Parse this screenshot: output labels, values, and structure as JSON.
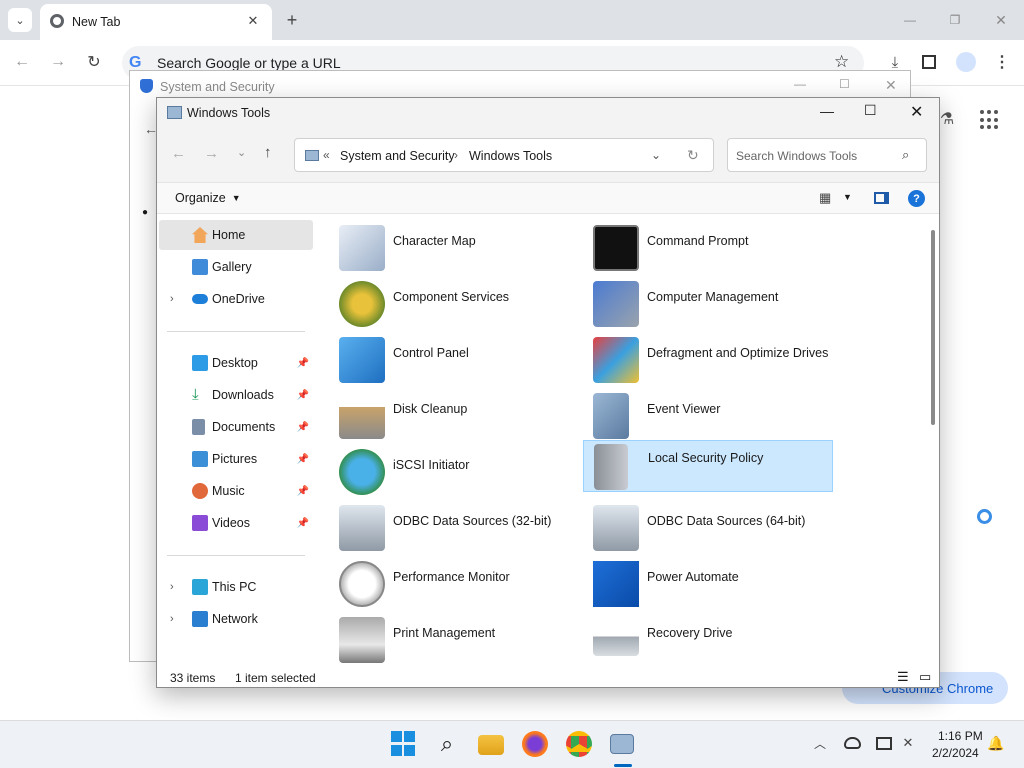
{
  "chrome": {
    "tab_title": "New Tab",
    "omnibox_placeholder": "Search Google or type a URL",
    "customize_label": "Customize Chrome"
  },
  "sys_window": {
    "title": "System and Security"
  },
  "explorer": {
    "title": "Windows Tools",
    "breadcrumb": {
      "root_chevrons": "«",
      "parent": "System and Security",
      "sep": "›",
      "current": "Windows Tools"
    },
    "search_placeholder": "Search Windows Tools",
    "organize_label": "Organize",
    "nav": {
      "home": "Home",
      "gallery": "Gallery",
      "onedrive": "OneDrive",
      "desktop": "Desktop",
      "downloads": "Downloads",
      "documents": "Documents",
      "pictures": "Pictures",
      "music": "Music",
      "videos": "Videos",
      "thispc": "This PC",
      "network": "Network"
    },
    "items": [
      "Character Map",
      "Command Prompt",
      "Component Services",
      "Computer Management",
      "Control Panel",
      "Defragment and Optimize Drives",
      "Disk Cleanup",
      "Event Viewer",
      "iSCSI Initiator",
      "Local Security Policy",
      "ODBC Data Sources (32-bit)",
      "ODBC Data Sources (64-bit)",
      "Performance Monitor",
      "Power Automate",
      "Print Management",
      "Recovery Drive"
    ],
    "status": {
      "count": "33 items",
      "selected": "1 item selected"
    }
  },
  "taskbar": {
    "time": "1:16 PM",
    "date": "2/2/2024"
  },
  "colors": {
    "accent": "#0067c0",
    "selection": "#cce8ff",
    "selection_border": "#99d1ff"
  }
}
